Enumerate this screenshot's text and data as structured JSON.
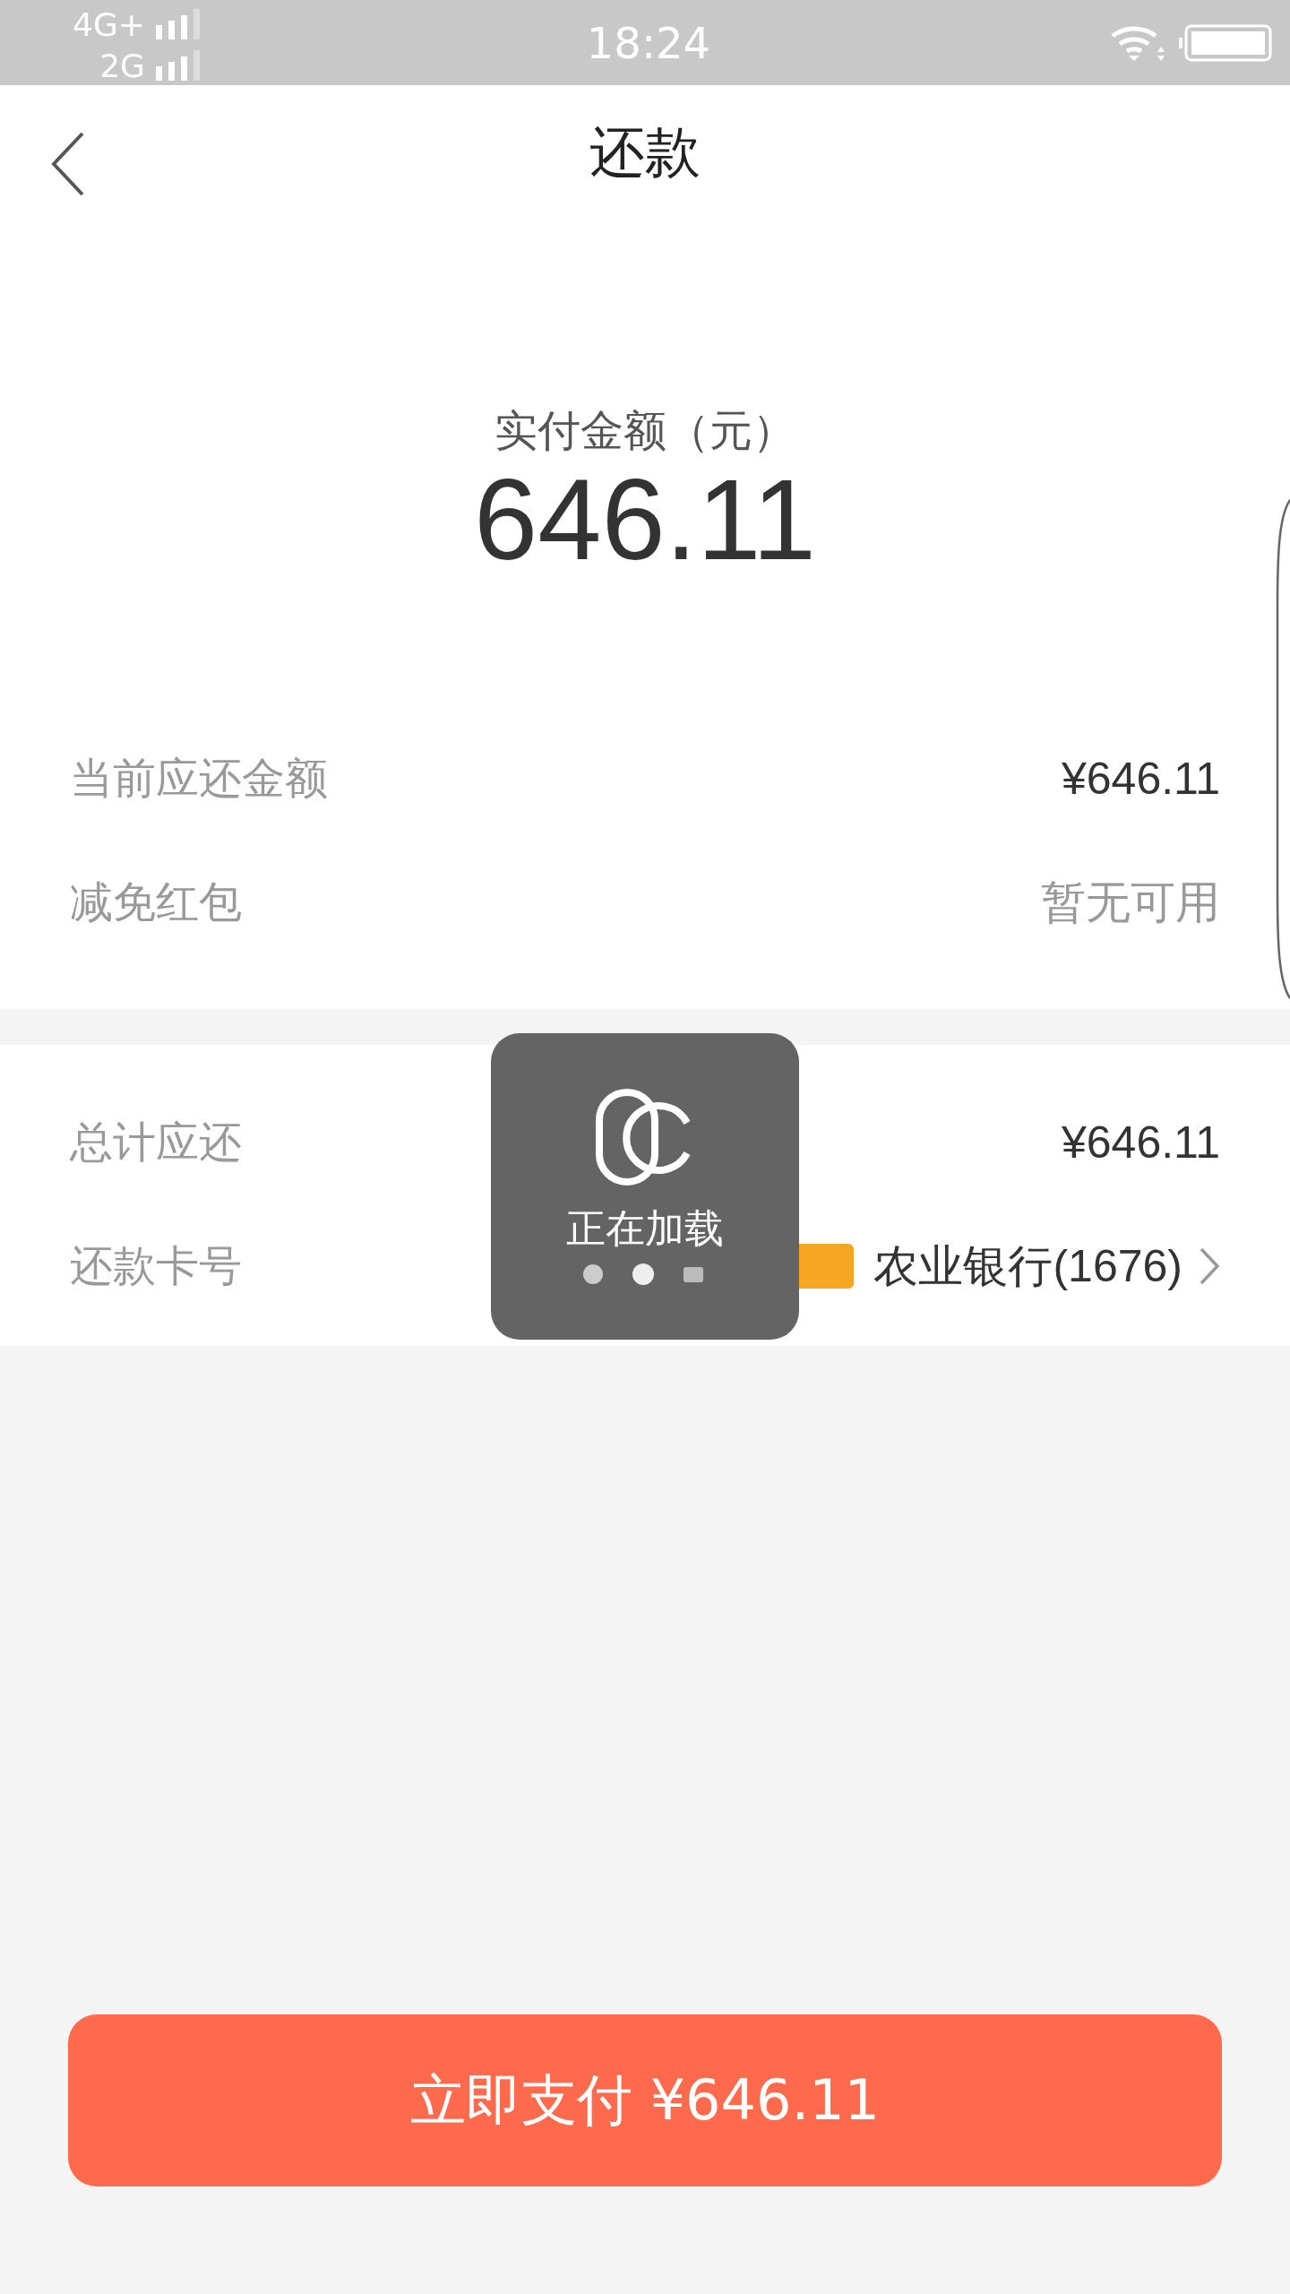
{
  "status_bar": {
    "networks": [
      {
        "label": "4G+"
      },
      {
        "label": "2G"
      }
    ],
    "time": "18:24"
  },
  "nav": {
    "title": "还款"
  },
  "summary": {
    "label": "实付金额（元）",
    "amount": "646.11"
  },
  "details": [
    {
      "label": "当前应还金额",
      "value": "¥646.11",
      "kind": "amount"
    },
    {
      "label": "减免红包",
      "value": "暂无可用",
      "kind": "muted"
    }
  ],
  "totals": [
    {
      "kind": "value",
      "label": "总计应还",
      "value": "¥646.11"
    },
    {
      "kind": "card",
      "label": "还款卡号",
      "badge_shown": true,
      "value": "农业银行(1676)"
    }
  ],
  "loading": {
    "text": "正在加载"
  },
  "pay_button": {
    "label": "立即支付 ¥646.11"
  }
}
